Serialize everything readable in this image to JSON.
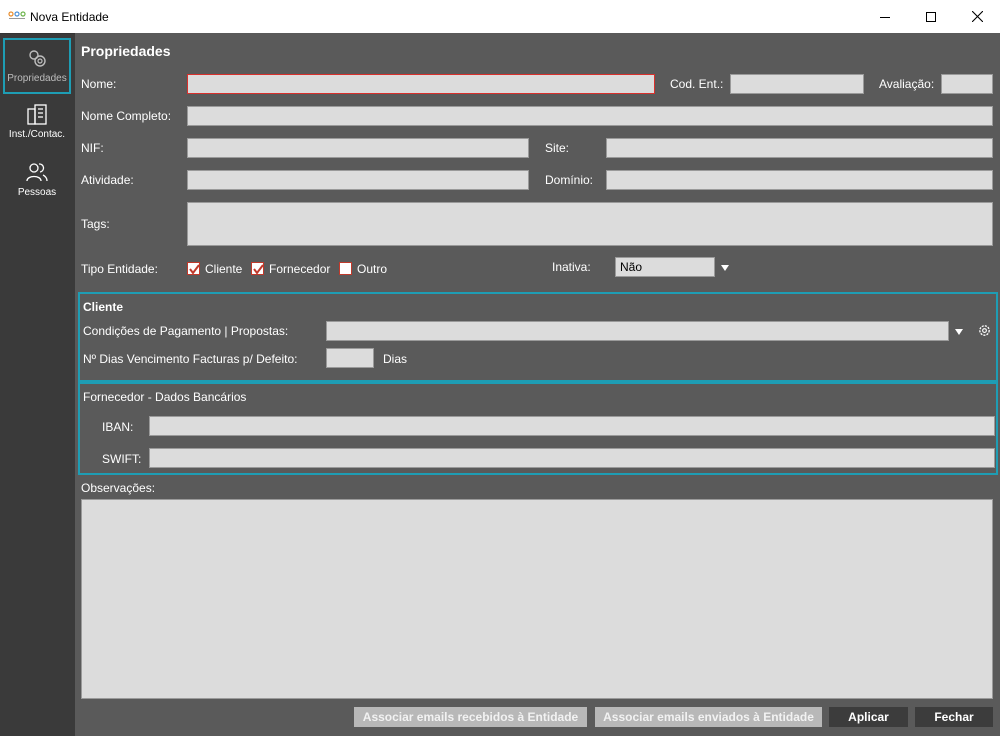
{
  "window": {
    "title": "Nova Entidade"
  },
  "sidebar": {
    "items": [
      {
        "label": "Propriedades",
        "icon": "gears-icon"
      },
      {
        "label": "Inst./Contac.",
        "icon": "building-icon"
      },
      {
        "label": "Pessoas",
        "icon": "people-icon"
      }
    ]
  },
  "properties": {
    "heading": "Propriedades",
    "nome_label": "Nome:",
    "cod_label": "Cod. Ent.:",
    "avaliacao_label": "Avaliação:",
    "nome_completo_label": "Nome Completo:",
    "nif_label": "NIF:",
    "site_label": "Site:",
    "atividade_label": "Atividade:",
    "dominio_label": "Domínio:",
    "tags_label": "Tags:",
    "tipo_label": "Tipo Entidade:",
    "tipo_options": [
      {
        "label": "Cliente",
        "checked": true
      },
      {
        "label": "Fornecedor",
        "checked": true
      },
      {
        "label": "Outro",
        "checked": false
      }
    ],
    "inativa_label": "Inativa:",
    "inativa_value": "Não"
  },
  "cliente": {
    "title": "Cliente",
    "condicoes_label": "Condições de Pagamento | Propostas:",
    "dias_label": "Nº Dias Vencimento Facturas p/ Defeito:",
    "dias_unit": "Dias"
  },
  "fornecedor": {
    "title": "Fornecedor - Dados Bancários",
    "iban_label": "IBAN:",
    "swift_label": "SWIFT:"
  },
  "observacoes": {
    "label": "Observações:"
  },
  "footer": {
    "assoc_recebidos": "Associar emails recebidos à Entidade",
    "assoc_enviados": "Associar emails enviados à Entidade",
    "aplicar": "Aplicar",
    "fechar": "Fechar"
  },
  "colors": {
    "accent": "#1e9db4",
    "required": "#d9302c",
    "check": "#c0392b"
  }
}
